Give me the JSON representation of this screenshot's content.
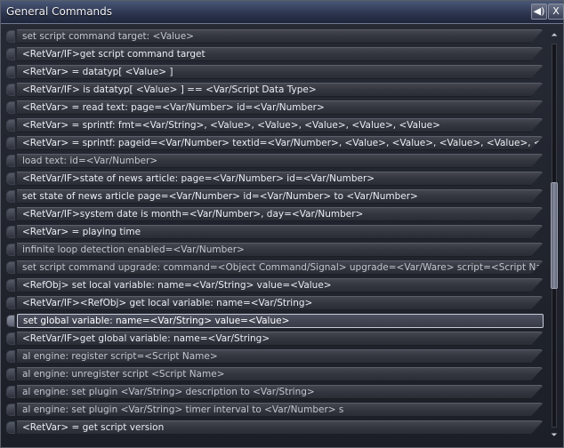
{
  "window": {
    "title": "General Commands"
  },
  "titlebar": {
    "sound_glyph": "◀)",
    "close_glyph": "X"
  },
  "scroll": {
    "up_glyph": "⏶",
    "down_glyph": "⏷",
    "position_fraction": 0.5
  },
  "commands": [
    "set script command target: <Value>",
    "<RetVar/IF>get script command target",
    "<RetVar> =  datatyp[ <Value> ]",
    "<RetVar/IF> is datatyp[ <Value> ] == <Var/Script Data Type>",
    "<RetVar> =  read text: page=<Var/Number> id=<Var/Number>",
    "<RetVar> = sprintf: fmt=<Var/String>, <Value>, <Value>, <Value>, <Value>, <Value>",
    "<RetVar> = sprintf: pageid=<Var/Number> textid=<Var/Number>, <Value>, <Value>, <Value>, <Value>, <Value>",
    "load text: id=<Var/Number>",
    "<RetVar/IF>state of news article: page=<Var/Number> id=<Var/Number>",
    "set state of news article page=<Var/Number> id=<Var/Number> to <Var/Number>",
    "<RetVar/IF>system date is month=<Var/Number>, day=<Var/Number>",
    "<RetVar> = playing time",
    "infinite loop detection enabled=<Var/Number>",
    "set script command upgrade: command=<Object Command/Signal>  upgrade=<Var/Ware>  script=<Script Name>",
    "<RefObj> set local variable: name=<Var/String> value=<Value>",
    "<RetVar/IF><RefObj> get local variable: name=<Var/String>",
    "set global variable: name=<Var/String> value=<Value>",
    "<RetVar/IF>get global variable: name=<Var/String>",
    "al engine: register script=<Script Name>",
    "al engine: unregister script <Script Name>",
    "al engine: set plugin <Var/String> description to <Var/String>",
    "al engine: set plugin <Var/String> timer interval to <Var/Number> s",
    "<RetVar> = get script version"
  ],
  "selected_index": 16,
  "dim_indices": [
    0,
    7,
    12,
    13,
    18,
    19,
    20,
    21
  ]
}
